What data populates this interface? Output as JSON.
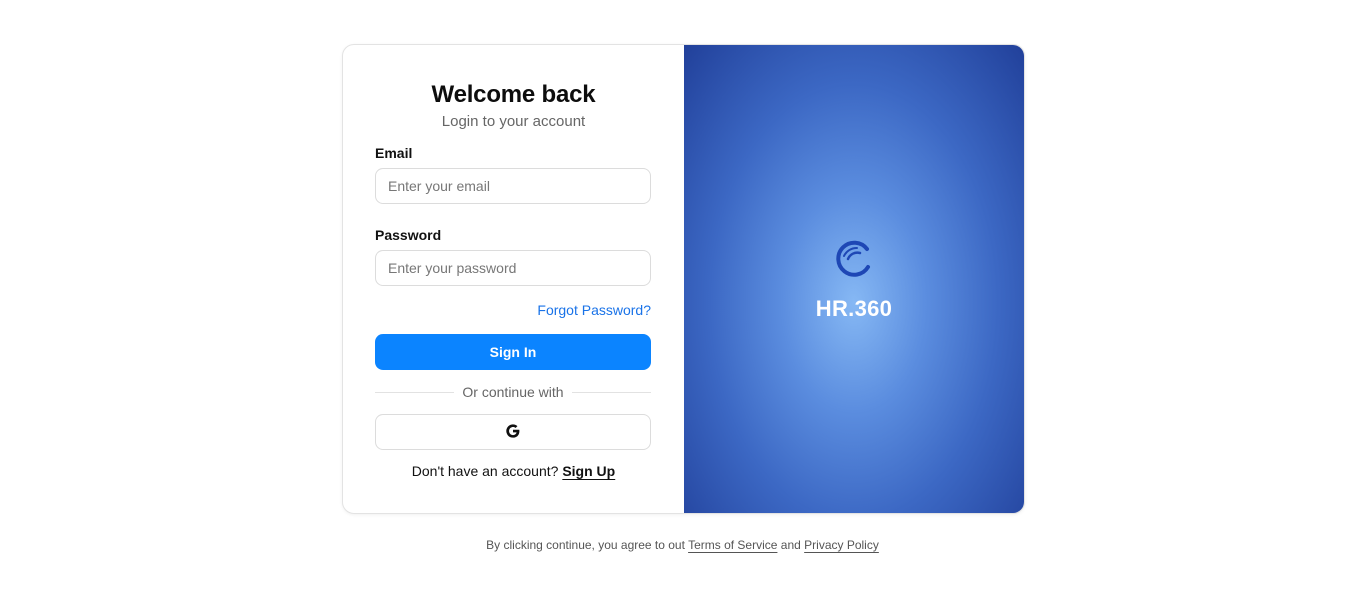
{
  "form": {
    "title": "Welcome back",
    "subtitle": "Login to your account",
    "email_label": "Email",
    "email_placeholder": "Enter your email",
    "email_value": "",
    "password_label": "Password",
    "password_placeholder": "Enter your password",
    "password_value": "",
    "forgot_password": "Forgot Password?",
    "signin_label": "Sign In",
    "divider_text": "Or continue with",
    "google_icon": "google-icon",
    "signup_prompt": "Don't have an account?",
    "signup_link": "Sign Up"
  },
  "brand": {
    "logo_icon": "hr360-logo-icon",
    "name": "HR.360",
    "accent_color": "#0b84ff"
  },
  "footer": {
    "prefix": "By clicking continue, you agree to out",
    "terms": "Terms of Service",
    "conjunction": "and",
    "privacy": "Privacy Policy"
  }
}
